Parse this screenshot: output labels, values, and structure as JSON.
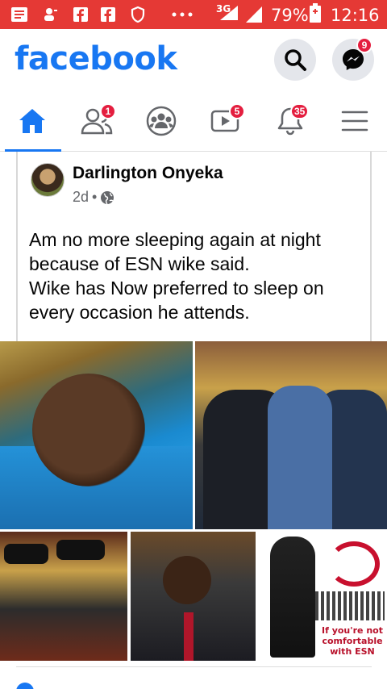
{
  "status_bar": {
    "network": "3G",
    "battery": "79%",
    "time": "12:16",
    "icons": [
      "notification-icon",
      "user-icon",
      "facebook-icon",
      "facebook-icon",
      "shield-icon",
      "more-dots-icon",
      "signal-icon",
      "battery-icon"
    ]
  },
  "header": {
    "logo": "facebook",
    "messenger_badge": "9"
  },
  "tabs": {
    "friends_badge": "1",
    "watch_badge": "5",
    "notifications_badge": "35"
  },
  "post": {
    "author": "Darlington Onyeka",
    "time": "2d",
    "separator": "•",
    "text_lines": [
      "Am no more sleeping again at night",
      "because of ESN  wike said.",
      "Wike has Now preferred to sleep on",
      "every occasion he attends."
    ],
    "image_caption": "If you're not comfortable with ESN"
  },
  "colors": {
    "brand": "#1877f2",
    "status_bar": "#e53935",
    "badge": "#e41e3f"
  }
}
